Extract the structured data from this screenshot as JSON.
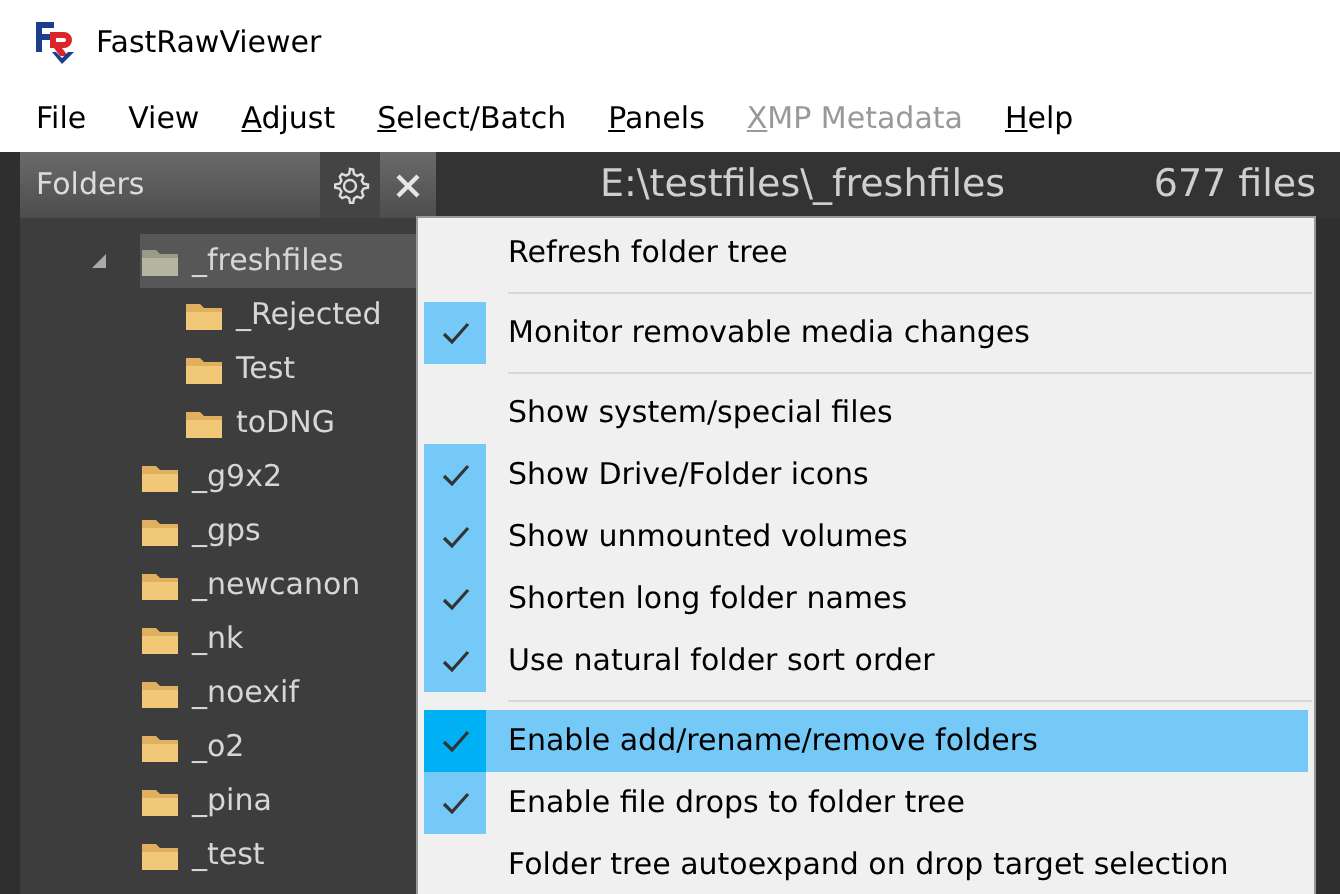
{
  "window": {
    "title": "FastRawViewer"
  },
  "menubar": [
    {
      "label": "File",
      "mnemonic": false,
      "disabled": false
    },
    {
      "label": "View",
      "mnemonic": false,
      "disabled": false
    },
    {
      "label": "Adjust",
      "mnemonic": true,
      "disabled": false
    },
    {
      "label": "Select/Batch",
      "mnemonic": true,
      "disabled": false
    },
    {
      "label": "Panels",
      "mnemonic": true,
      "disabled": false
    },
    {
      "label": "XMP Metadata",
      "mnemonic": true,
      "disabled": true
    },
    {
      "label": "Help",
      "mnemonic": true,
      "disabled": false
    }
  ],
  "folders_panel": {
    "title": "Folders",
    "tree": [
      {
        "label": "_freshfiles",
        "expanded": true,
        "selected": true,
        "children": [
          {
            "label": "_Rejected",
            "selected": false
          },
          {
            "label": "Test",
            "selected": false
          },
          {
            "label": "toDNG",
            "selected": false
          }
        ]
      },
      {
        "label": "_g9x2",
        "selected": false
      },
      {
        "label": "_gps",
        "selected": false
      },
      {
        "label": "_newcanon",
        "selected": false
      },
      {
        "label": "_nk",
        "selected": false
      },
      {
        "label": "_noexif",
        "selected": false
      },
      {
        "label": "_o2",
        "selected": false
      },
      {
        "label": "_pina",
        "selected": false
      },
      {
        "label": "_test",
        "selected": false
      }
    ]
  },
  "browser_header": {
    "path": "E:\\testfiles\\_freshfiles",
    "count": "677 files"
  },
  "context_menu": [
    {
      "kind": "action",
      "label": "Refresh folder tree",
      "highlighted": false
    },
    {
      "kind": "separator"
    },
    {
      "kind": "toggle",
      "label": "Monitor removable media changes",
      "checked": true,
      "highlighted": false
    },
    {
      "kind": "separator"
    },
    {
      "kind": "toggle",
      "label": "Show system/special files",
      "checked": false,
      "highlighted": false
    },
    {
      "kind": "toggle",
      "label": "Show Drive/Folder icons",
      "checked": true,
      "highlighted": false
    },
    {
      "kind": "toggle",
      "label": "Show unmounted volumes",
      "checked": true,
      "highlighted": false
    },
    {
      "kind": "toggle",
      "label": "Shorten long folder names",
      "checked": true,
      "highlighted": false
    },
    {
      "kind": "toggle",
      "label": "Use natural folder sort order",
      "checked": true,
      "highlighted": false
    },
    {
      "kind": "separator"
    },
    {
      "kind": "toggle",
      "label": "Enable add/rename/remove folders",
      "checked": true,
      "highlighted": true
    },
    {
      "kind": "toggle",
      "label": "Enable file drops to folder tree",
      "checked": true,
      "highlighted": false
    },
    {
      "kind": "toggle",
      "label": "Folder tree autoexpand on drop target selection",
      "checked": false,
      "highlighted": false
    }
  ]
}
